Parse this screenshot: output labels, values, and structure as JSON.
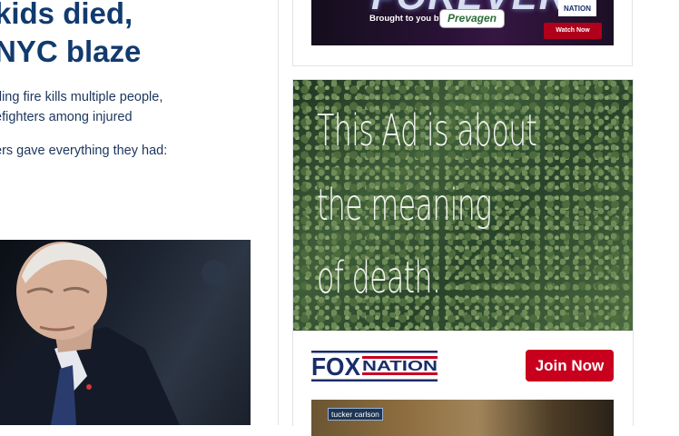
{
  "article": {
    "headline_lines": [
      "kids died,",
      "NYC blaze"
    ],
    "dek_lines": [
      "ding fire kills multiple people,",
      "efighters among injured"
    ],
    "teaser": "ers gave everything they had:"
  },
  "sidebar": {
    "top_banner": {
      "title": "FOREVER",
      "brought_by": "Brought to you by",
      "sponsor": "Prevagen",
      "badge": "NATION",
      "watch": "Watch Now"
    },
    "ad": {
      "lines": [
        "This Ad is about",
        "the meaning",
        "of death."
      ],
      "logo": {
        "word1": "FOX",
        "word2": "NATION"
      },
      "cta": "Join Now",
      "thumb_tag": "tucker carlson"
    }
  },
  "colors": {
    "headline": "#113a6e",
    "body_text": "#1b365d",
    "cta_red": "#c8001e",
    "fox_blue": "#1a2d6a",
    "divider": "#dfe4ea"
  }
}
